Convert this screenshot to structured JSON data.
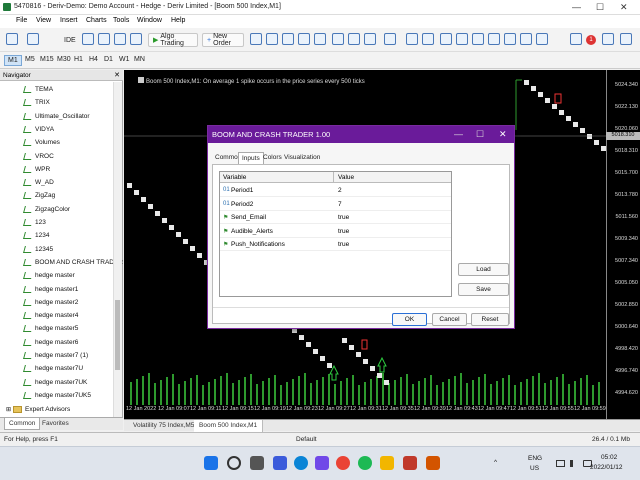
{
  "window": {
    "title": "5470816 - Deriv-Demo: Demo Account - Hedge - Deriv Limited - [Boom 500 Index,M1]"
  },
  "menu": [
    "File",
    "View",
    "Insert",
    "Charts",
    "Tools",
    "Window",
    "Help"
  ],
  "toolbar": {
    "ide_label": "IDE",
    "algo_label": "Algo Trading",
    "new_order_label": "New Order"
  },
  "timeframes": [
    "M1",
    "M5",
    "M15",
    "M30",
    "H1",
    "H4",
    "D1",
    "W1",
    "MN"
  ],
  "navigator": {
    "title": "Navigator",
    "items": [
      "TEMA",
      "TRIX",
      "Ultimate_Oscillator",
      "VIDYA",
      "Volumes",
      "VROC",
      "WPR",
      "W_AD",
      "ZigZag",
      "ZigzagColor",
      "123",
      "1234",
      "12345",
      "BOOM AND CRASH TRADER",
      "hedge master",
      "hedge master1",
      "hedge master2",
      "hedge master4",
      "hedge master5",
      "hedge master6",
      "hedge master7 (1)",
      "hedge master7U",
      "hedge master7UK",
      "hedge master7UK5"
    ],
    "folder": "Expert Advisors",
    "tabs": [
      "Common",
      "Favorites"
    ]
  },
  "chart": {
    "info": "Boom 500 Index,M1: On average 1 spike occurs in the price series every 500 ticks",
    "prices": [
      "5024.340",
      "5022.130",
      "5020.060",
      "5018.310",
      "5015.700",
      "5013.780",
      "5011.560",
      "5009.340",
      "5007.340",
      "5005.050",
      "5002.850",
      "5000.640",
      "4998.420",
      "4996.740",
      "4994.620"
    ],
    "current_price": "5018.310",
    "times": [
      "12 Jan 2022",
      "12 Jan 09:07",
      "12 Jan 09:11",
      "12 Jan 09:15",
      "12 Jan 09:19",
      "12 Jan 09:23",
      "12 Jan 09:27",
      "12 Jan 09:31",
      "12 Jan 09:35",
      "12 Jan 09:39",
      "12 Jan 09:43",
      "12 Jan 09:47",
      "12 Jan 09:51",
      "12 Jan 09:55",
      "12 Jan 09:59"
    ],
    "tabs": [
      "Volatility 75 Index,M5",
      "Boom 500 Index,M1"
    ]
  },
  "dialog": {
    "title": "BOOM AND CRASH TRADER 1.00",
    "tabs": [
      "Common",
      "Inputs",
      "Colors",
      "Visualization"
    ],
    "col_variable": "Variable",
    "col_value": "Value",
    "params": [
      {
        "type": "01",
        "name": "Period1",
        "value": "2"
      },
      {
        "type": "01",
        "name": "Period2",
        "value": "7"
      },
      {
        "type": "bool",
        "name": "Send_Email",
        "value": "true"
      },
      {
        "type": "bool",
        "name": "Audible_Alerts",
        "value": "true"
      },
      {
        "type": "bool",
        "name": "Push_Notifications",
        "value": "true"
      }
    ],
    "load_label": "Load",
    "save_label": "Save",
    "ok_label": "OK",
    "cancel_label": "Cancel",
    "reset_label": "Reset"
  },
  "status": {
    "help": "For Help, press F1",
    "profile": "Default",
    "traffic": "26.4 / 0.1 Mb"
  },
  "taskbar": {
    "lang": "ENG",
    "region": "US",
    "time": "05:02",
    "date": "2022/01/12"
  }
}
